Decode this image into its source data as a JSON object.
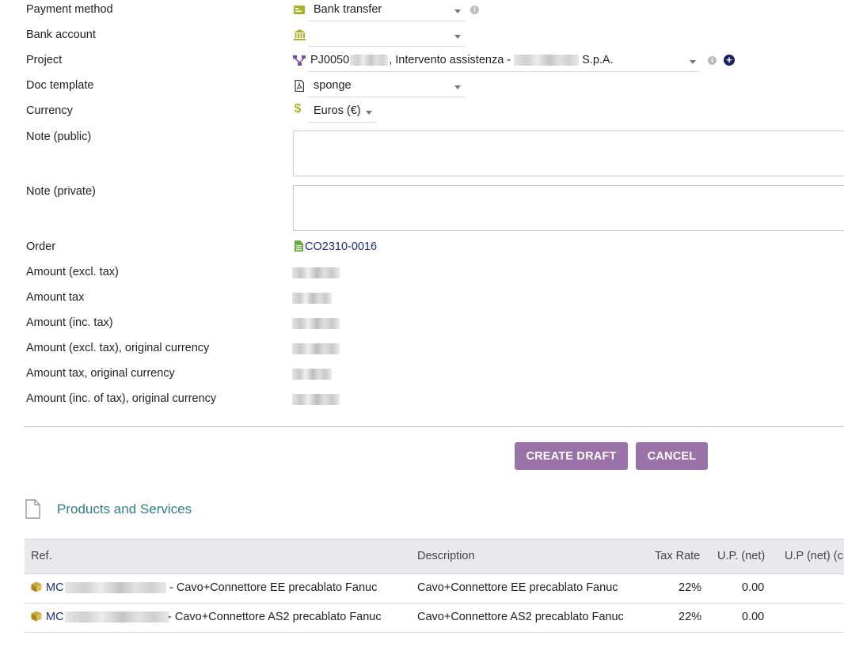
{
  "fields": {
    "payment_method": {
      "label": "Payment method",
      "value": "Bank transfer"
    },
    "bank_account": {
      "label": "Bank account",
      "value": ""
    },
    "project": {
      "label": "Project",
      "value_prefix": "PJ0050",
      "value_middle": ", Intervento assistenza -",
      "value_suffix": "S.p.A."
    },
    "doc_template": {
      "label": "Doc template",
      "value": "sponge"
    },
    "currency": {
      "label": "Currency",
      "value": "Euros (€)"
    },
    "note_public": {
      "label": "Note (public)",
      "value": ""
    },
    "note_private": {
      "label": "Note (private)",
      "value": ""
    },
    "order": {
      "label": "Order",
      "value": "CO2310-0016"
    },
    "amount_excl_tax": {
      "label": "Amount (excl. tax)"
    },
    "amount_tax": {
      "label": "Amount tax"
    },
    "amount_inc_tax": {
      "label": "Amount (inc. tax)"
    },
    "amount_excl_tax_orig": {
      "label": "Amount (excl. tax), original currency"
    },
    "amount_tax_orig": {
      "label": "Amount tax, original currency"
    },
    "amount_inc_tax_orig": {
      "label": "Amount (inc. of tax), original currency"
    }
  },
  "buttons": {
    "create_draft": "CREATE DRAFT",
    "cancel": "CANCEL"
  },
  "products": {
    "title": "Products and Services",
    "columns": [
      "Ref.",
      "Description",
      "Tax Rate",
      "U.P. (net)",
      "U.P (net) (c"
    ],
    "rows": [
      {
        "ref_prefix": "MC",
        "ref_suffix": "- Cavo+Connettore EE precablato Fanuc",
        "description": "Cavo+Connettore EE precablato Fanuc",
        "tax_rate": "22%",
        "up_net": "0.00"
      },
      {
        "ref_prefix": "MC",
        "ref_suffix": "- Cavo+Connettore AS2 precablato Fanuc",
        "description": "Cavo+Connettore AS2 precablato Fanuc",
        "tax_rate": "22%",
        "up_net": "0.00"
      }
    ]
  },
  "colors": {
    "button": "#9a72a8",
    "section_title": "#2e7d86",
    "link": "#1c2e7a",
    "icon_green": "#a8b32a"
  },
  "icons": [
    "payment-card-icon",
    "bank-icon",
    "project-icon",
    "pdf-icon",
    "dollar-icon",
    "order-document-icon",
    "product-box-icon",
    "file-icon",
    "info-icon",
    "plus-circle-icon"
  ]
}
